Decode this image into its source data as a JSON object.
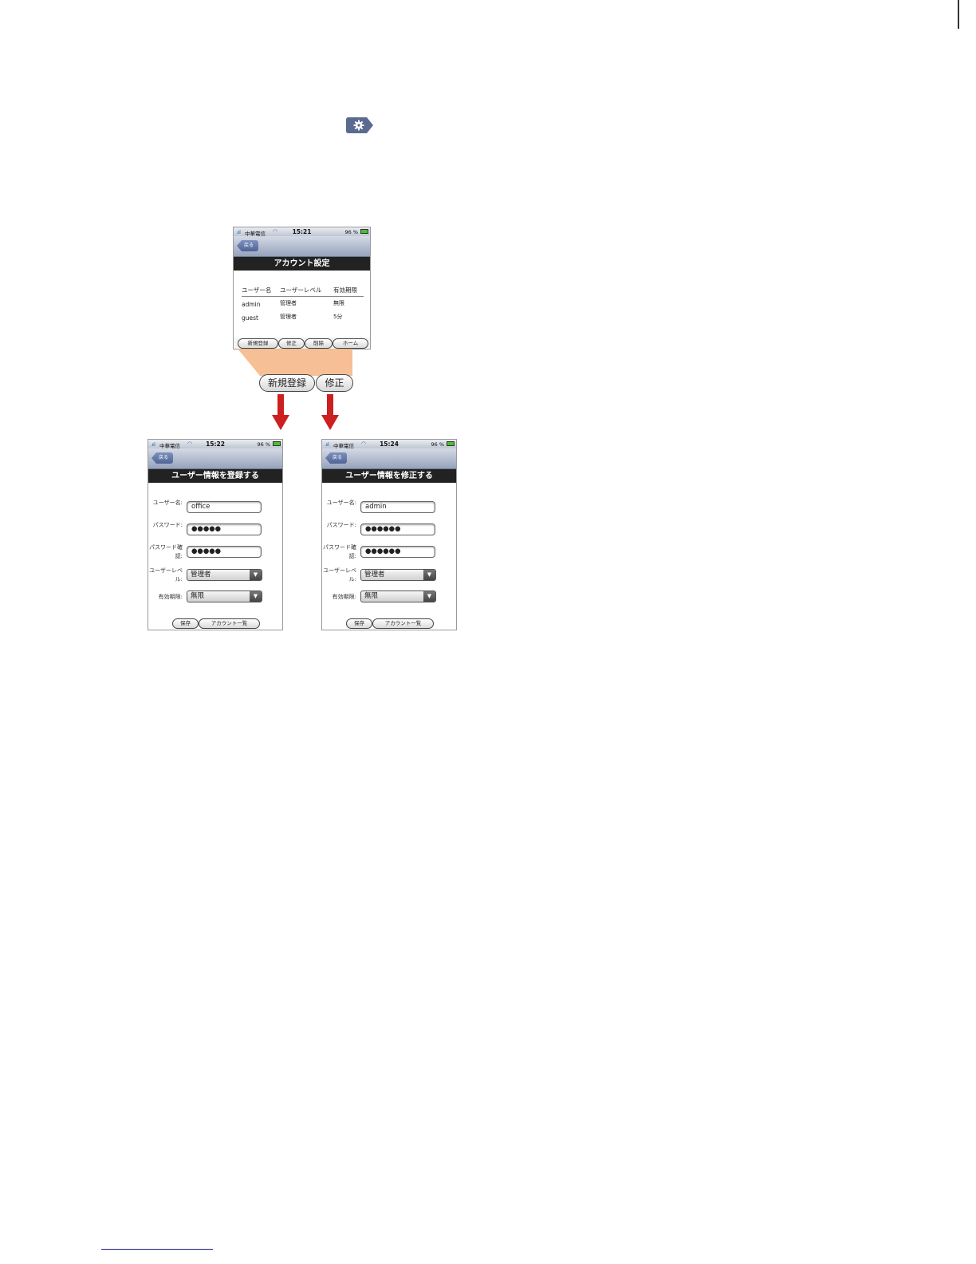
{
  "colors": {
    "accent_red": "#cc1f1f",
    "callout_orange": "#f6b88a",
    "nav_blue": "#4f6497"
  },
  "icons": {
    "settings_tab": "gear-icon"
  },
  "account_screen": {
    "status": {
      "carrier": "中華電信",
      "time": "15:21",
      "battery": "96 %"
    },
    "back_label": "戻る",
    "title": "アカウント設定",
    "columns": [
      "ユーザー名",
      "ユーザーレベル",
      "有効期限"
    ],
    "rows": [
      {
        "name": "admin",
        "level": "管理者",
        "expiry": "無限"
      },
      {
        "name": "guest",
        "level": "管理者",
        "expiry": "5分"
      }
    ],
    "buttons": {
      "new": "新規登録",
      "edit": "修正",
      "delete": "削除",
      "home": "ホーム"
    }
  },
  "callout": {
    "new": "新規登録",
    "edit": "修正"
  },
  "register_screen": {
    "status": {
      "carrier": "中華電信",
      "time": "15:22",
      "battery": "96 %"
    },
    "back_label": "戻る",
    "title": "ユーザー情報を登録する",
    "labels": {
      "username": "ユーザー名:",
      "password": "パスワード:",
      "confirm": "パスワード確認:",
      "level": "ユーザーレベル:",
      "expiry": "有効期限:"
    },
    "values": {
      "username": "office",
      "password": "●●●●●",
      "confirm": "●●●●●",
      "level": "管理者",
      "expiry": "無限"
    },
    "buttons": {
      "save": "保存",
      "list": "アカウント一覧"
    }
  },
  "edit_screen": {
    "status": {
      "carrier": "中華電信",
      "time": "15:24",
      "battery": "96 %"
    },
    "back_label": "戻る",
    "title": "ユーザー情報を修正する",
    "labels": {
      "username": "ユーザー名:",
      "password": "パスワード:",
      "confirm": "パスワード確認:",
      "level": "ユーザーレベル:",
      "expiry": "有効期限:"
    },
    "values": {
      "username": "admin",
      "password": "●●●●●●",
      "confirm": "●●●●●●",
      "level": "管理者",
      "expiry": "無限"
    },
    "buttons": {
      "save": "保存",
      "list": "アカウント一覧"
    }
  }
}
